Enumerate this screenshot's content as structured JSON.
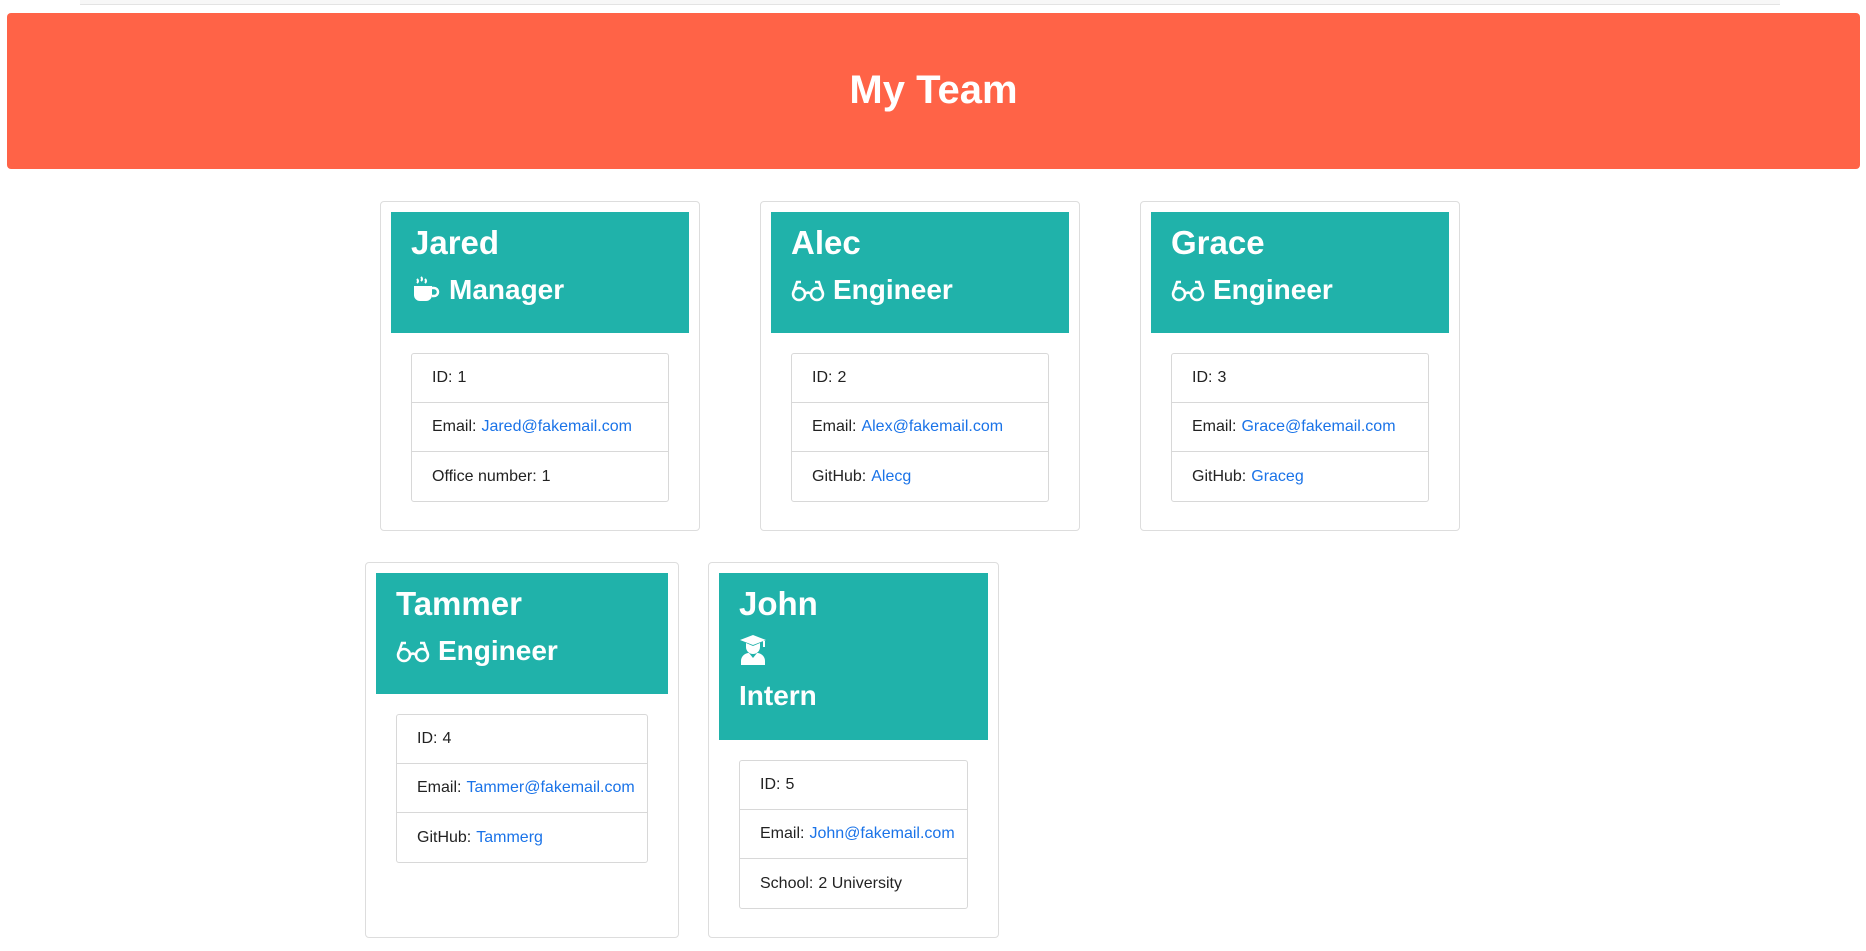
{
  "header": {
    "title": "My Team"
  },
  "colors": {
    "banner": "#ff6347",
    "card_header": "#20b2aa",
    "link": "#1a73e8"
  },
  "employees": [
    {
      "name": "Jared",
      "role": "Manager",
      "role_icon": "coffee-icon",
      "id_label": "ID:",
      "id": "1",
      "email_label": "Email:",
      "email": "Jared@fakemail.com",
      "extra_label": "Office number:",
      "extra": "1"
    },
    {
      "name": "Alec",
      "role": "Engineer",
      "role_icon": "glasses-icon",
      "id_label": "ID:",
      "id": "2",
      "email_label": "Email:",
      "email": "Alex@fakemail.com",
      "extra_label": "GitHub:",
      "extra": "Alecg"
    },
    {
      "name": "Grace",
      "role": "Engineer",
      "role_icon": "glasses-icon",
      "id_label": "ID:",
      "id": "3",
      "email_label": "Email:",
      "email": "Grace@fakemail.com",
      "extra_label": "GitHub:",
      "extra": "Graceg"
    },
    {
      "name": "Tammer",
      "role": "Engineer",
      "role_icon": "glasses-icon",
      "id_label": "ID:",
      "id": "4",
      "email_label": "Email:",
      "email": "Tammer@fakemail.com",
      "extra_label": "GitHub:",
      "extra": "Tammerg"
    },
    {
      "name": "John",
      "role": "Intern",
      "role_icon": "graduate-icon",
      "id_label": "ID:",
      "id": "5",
      "email_label": "Email:",
      "email": "John@fakemail.com",
      "extra_label": "School:",
      "extra": "2 University"
    }
  ]
}
